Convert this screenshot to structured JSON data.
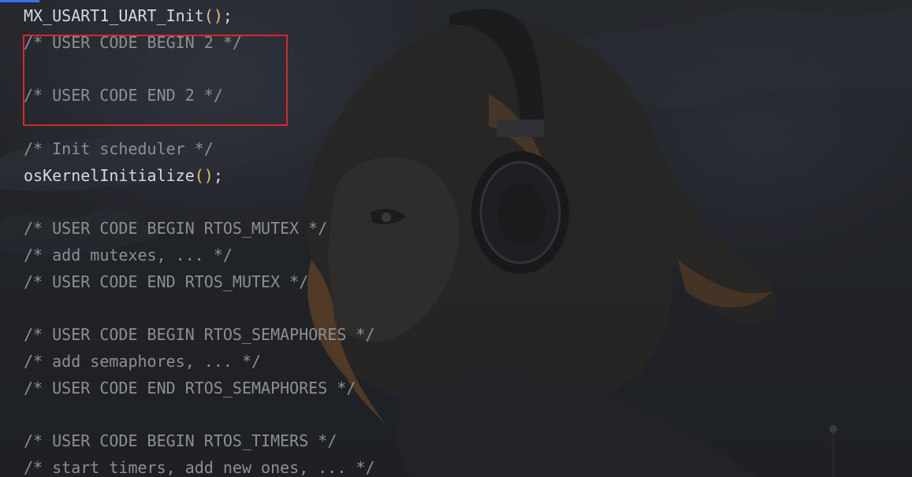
{
  "theme": {
    "accent": "#3574f0",
    "comment_color": "#8c8f94",
    "identifier_color": "#d6d8dc",
    "paren_color": "#e2c170",
    "highlight_color": "#e02525"
  },
  "background": {
    "image_icon": "anime-girl-headphones-wallpaper"
  },
  "code": {
    "lines": [
      {
        "kind": "call",
        "name": "MX_USART1_UART_Init",
        "parens": "()",
        "end": ";"
      },
      {
        "kind": "comment",
        "text": "/* USER CODE BEGIN 2 */"
      },
      {
        "kind": "blank",
        "text": ""
      },
      {
        "kind": "comment",
        "text": "/* USER CODE END 2 */"
      },
      {
        "kind": "blank",
        "text": ""
      },
      {
        "kind": "comment",
        "text": "/* Init scheduler */"
      },
      {
        "kind": "call",
        "name": "osKernelInitialize",
        "parens": "()",
        "end": ";"
      },
      {
        "kind": "blank",
        "text": ""
      },
      {
        "kind": "comment",
        "text": "/* USER CODE BEGIN RTOS_MUTEX */"
      },
      {
        "kind": "comment",
        "text": "/* add mutexes, ... */"
      },
      {
        "kind": "comment",
        "text": "/* USER CODE END RTOS_MUTEX */"
      },
      {
        "kind": "blank",
        "text": ""
      },
      {
        "kind": "comment",
        "text": "/* USER CODE BEGIN RTOS_SEMAPHORES */"
      },
      {
        "kind": "comment",
        "text": "/* add semaphores, ... */"
      },
      {
        "kind": "comment",
        "text": "/* USER CODE END RTOS_SEMAPHORES */"
      },
      {
        "kind": "blank",
        "text": ""
      },
      {
        "kind": "comment",
        "text": "/* USER CODE BEGIN RTOS_TIMERS */"
      },
      {
        "kind": "comment",
        "text": "/* start timers, add new ones, ... */"
      }
    ]
  }
}
